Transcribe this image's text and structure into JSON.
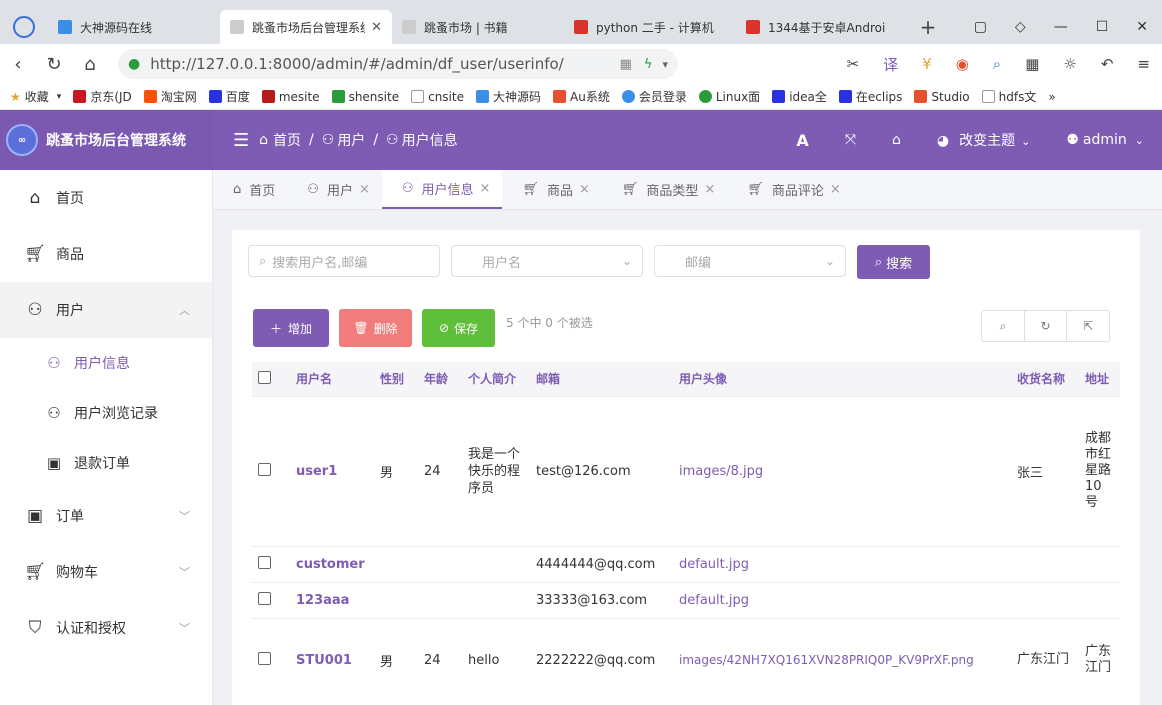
{
  "browser": {
    "tabs": [
      {
        "label": "大神源码在线",
        "color": "#3a8ee6"
      },
      {
        "label": "跳蚤市场后台管理系统",
        "color": "#888888",
        "active": true
      },
      {
        "label": "跳蚤市场 | 书籍",
        "color": "#888888"
      },
      {
        "label": "python 二手 - 计算机",
        "color": "#d9332e"
      },
      {
        "label": "1344基于安卓Androi",
        "color": "#d9332e"
      }
    ],
    "url": "http://127.0.0.1:8000/admin/#/admin/df_user/userinfo/",
    "bookmarks": [
      "收藏",
      "京东(JD",
      "淘宝网",
      "百度",
      "mesite",
      "shensite",
      "cnsite",
      "大神源码",
      "Au系统",
      "会员登录",
      "Linux面",
      "idea全",
      "在eclips",
      "Studio",
      "hdfs文"
    ]
  },
  "header": {
    "app_title": "跳蚤市场后台管理系统",
    "breadcrumb": [
      "首页",
      "用户",
      "用户信息"
    ],
    "font_label": "A",
    "theme_label": "改变主题",
    "user": "admin"
  },
  "sidebar": {
    "items": [
      {
        "label": "首页",
        "icon": "home-icon"
      },
      {
        "label": "商品",
        "icon": "cart-icon"
      },
      {
        "label": "用户",
        "icon": "user-icon"
      },
      {
        "label": "订单",
        "icon": "bag-icon"
      },
      {
        "label": "购物车",
        "icon": "cart-icon"
      },
      {
        "label": "认证和授权",
        "icon": "shield-icon"
      }
    ],
    "sub_items": [
      "用户信息",
      "用户浏览记录",
      "退款订单"
    ]
  },
  "page_tabs": [
    "首页",
    "用户",
    "用户信息",
    "商品",
    "商品类型",
    "商品评论"
  ],
  "filters": {
    "search_placeholder": "搜索用户名,邮编",
    "username_placeholder": "用户名",
    "email_placeholder": "邮编",
    "search_button": "搜索"
  },
  "toolbar": {
    "add": "增加",
    "delete": "删除",
    "save": "保存",
    "selection": "5 个中 0 个被选"
  },
  "table": {
    "columns": [
      "用户名",
      "性别",
      "年龄",
      "个人简介",
      "邮箱",
      "用户头像",
      "收货名称",
      "地址"
    ],
    "rows": [
      {
        "username": "user1",
        "gender": "男",
        "age": "24",
        "intro": "我是一个快乐的程序员",
        "email": "test@126.com",
        "avatar": "images/8.jpg",
        "receiver": "张三",
        "address": "成都市红星路10号"
      },
      {
        "username": "customer",
        "gender": "",
        "age": "",
        "intro": "",
        "email": "4444444@qq.com",
        "avatar": "default.jpg",
        "receiver": "",
        "address": ""
      },
      {
        "username": "123aaa",
        "gender": "",
        "age": "",
        "intro": "",
        "email": "33333@163.com",
        "avatar": "default.jpg",
        "receiver": "",
        "address": ""
      },
      {
        "username": "STU001",
        "gender": "男",
        "age": "24",
        "intro": "hello",
        "email": "2222222@qq.com",
        "avatar": "images/42NH7XQ161XVN28PRIQ0P_KV9PrXF.png",
        "receiver": "广东江门",
        "address": "广东江门"
      }
    ]
  },
  "colors": {
    "primary": "#7e5cb4",
    "danger": "#f07c7c",
    "success": "#5fbf3a"
  }
}
